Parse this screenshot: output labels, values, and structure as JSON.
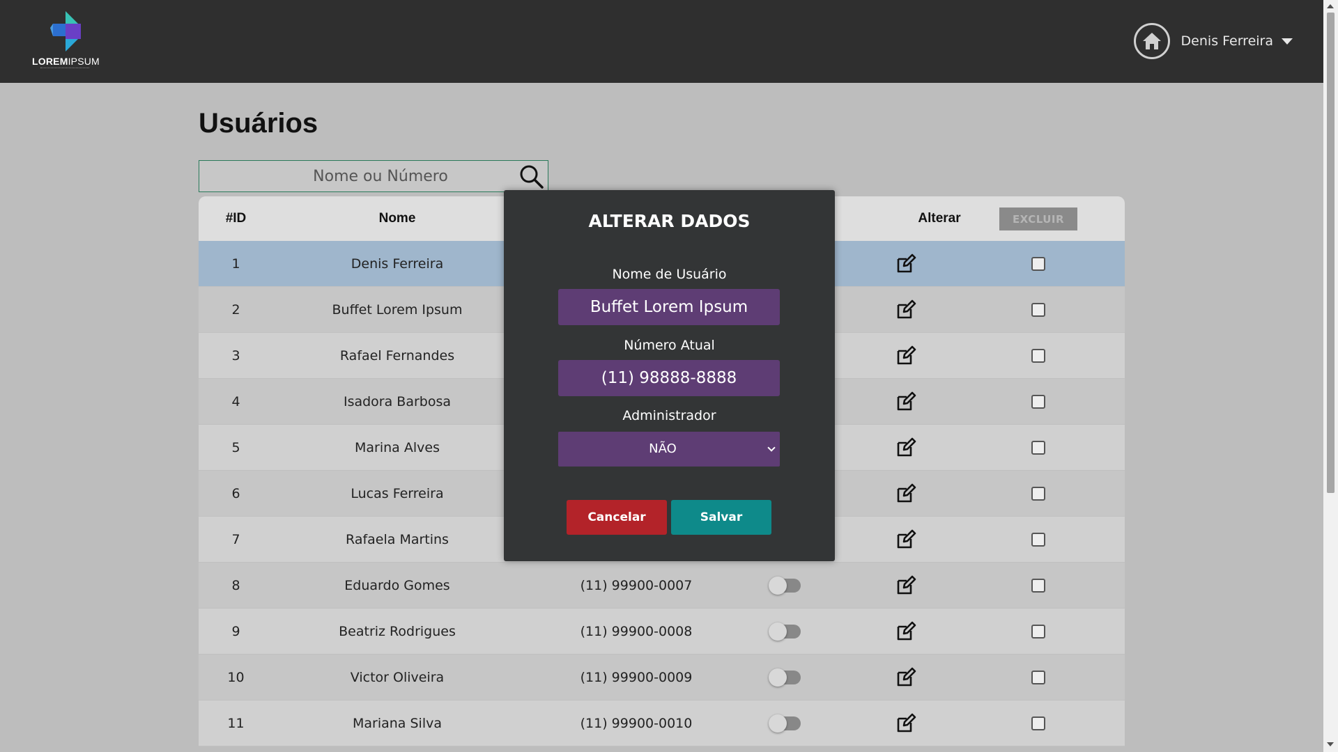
{
  "header": {
    "logo_text_bold": "LOREM",
    "logo_text_light": "IPSUM",
    "user_name": "Denis Ferreira"
  },
  "page": {
    "title": "Usuários"
  },
  "search": {
    "placeholder": "Nome ou Número"
  },
  "table": {
    "headers": {
      "id": "#ID",
      "name": "Nome",
      "edit": "Alterar",
      "delete_button": "EXCLUIR"
    },
    "rows": [
      {
        "id": "1",
        "name": "Denis Ferreira",
        "phone": ""
      },
      {
        "id": "2",
        "name": "Buffet Lorem Ipsum",
        "phone": ""
      },
      {
        "id": "3",
        "name": "Rafael Fernandes",
        "phone": ""
      },
      {
        "id": "4",
        "name": "Isadora Barbosa",
        "phone": ""
      },
      {
        "id": "5",
        "name": "Marina Alves",
        "phone": ""
      },
      {
        "id": "6",
        "name": "Lucas Ferreira",
        "phone": ""
      },
      {
        "id": "7",
        "name": "Rafaela Martins",
        "phone": ""
      },
      {
        "id": "8",
        "name": "Eduardo Gomes",
        "phone": "(11) 99900-0007"
      },
      {
        "id": "9",
        "name": "Beatriz Rodrigues",
        "phone": "(11) 99900-0008"
      },
      {
        "id": "10",
        "name": "Victor Oliveira",
        "phone": "(11) 99900-0009"
      },
      {
        "id": "11",
        "name": "Mariana Silva",
        "phone": "(11) 99900-0010"
      }
    ],
    "selected_row": "1"
  },
  "modal": {
    "title": "ALTERAR DADOS",
    "username_label": "Nome de Usuário",
    "username_value": "Buffet Lorem Ipsum",
    "phone_label": "Número Atual",
    "phone_value": "(11) 98888-8888",
    "admin_label": "Administrador",
    "admin_value": "NÃO",
    "cancel_label": "Cancelar",
    "save_label": "Salvar"
  },
  "colors": {
    "topbar": "#2f2f2f",
    "modal_bg": "#333536",
    "field_purple": "#5e3d74",
    "cancel_red": "#b32329",
    "save_teal": "#0e8a8a",
    "selected_row": "#9fb6cc"
  },
  "icons": {
    "logo": "logo-icon",
    "home": "home-icon",
    "search": "search-icon",
    "edit": "edit-icon",
    "dropdown": "chevron-down-icon"
  }
}
